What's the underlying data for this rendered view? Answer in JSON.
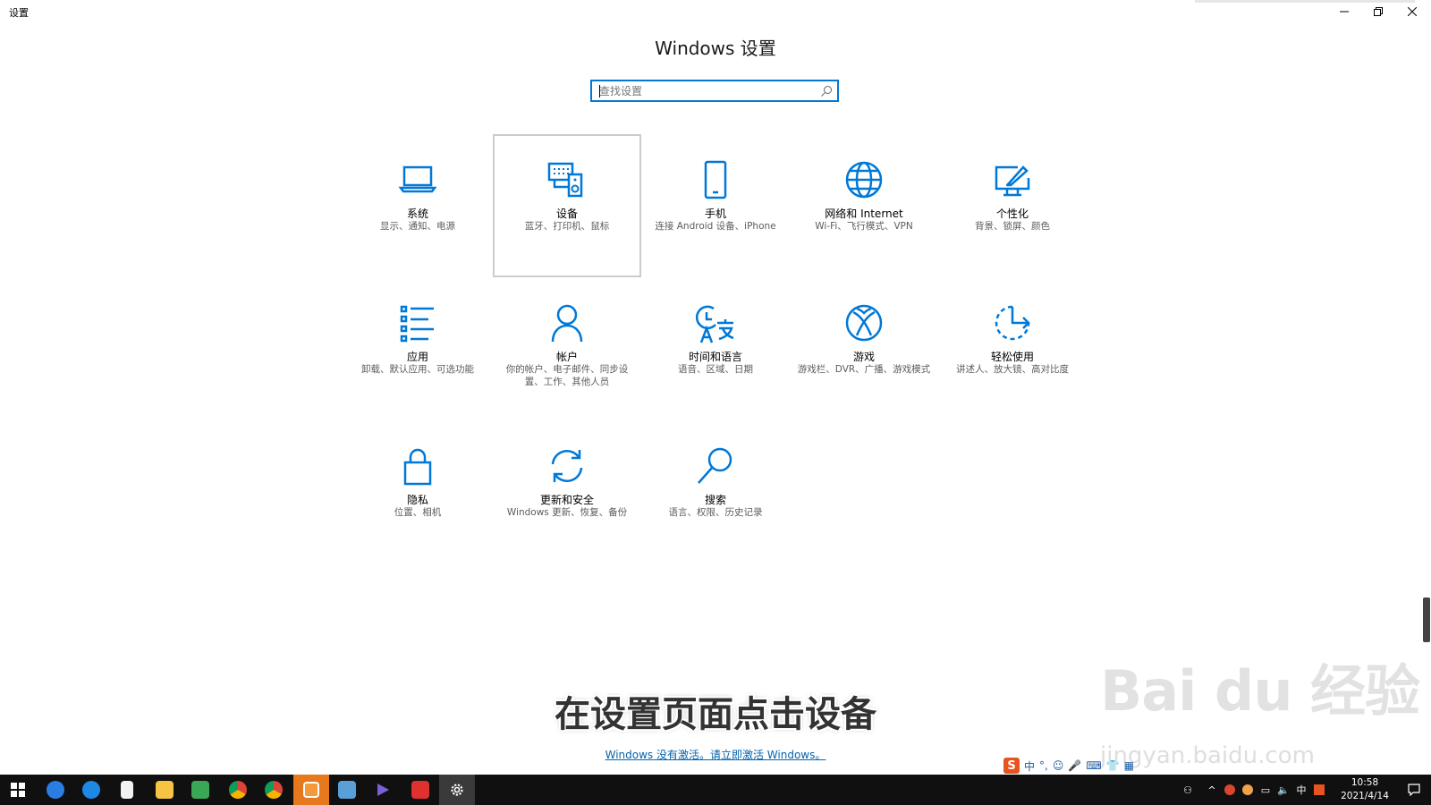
{
  "window": {
    "title": "设置"
  },
  "header": {
    "title": "Windows 设置"
  },
  "search": {
    "placeholder": "查找设置"
  },
  "tiles": [
    {
      "name": "系统",
      "desc": "显示、通知、电源"
    },
    {
      "name": "设备",
      "desc": "蓝牙、打印机、鼠标"
    },
    {
      "name": "手机",
      "desc": "连接 Android 设备、iPhone"
    },
    {
      "name": "网络和 Internet",
      "desc": "Wi-Fi、飞行模式、VPN"
    },
    {
      "name": "个性化",
      "desc": "背景、锁屏、颜色"
    },
    {
      "name": "应用",
      "desc": "卸载、默认应用、可选功能"
    },
    {
      "name": "帐户",
      "desc": "你的帐户、电子邮件、同步设置、工作、其他人员"
    },
    {
      "name": "时间和语言",
      "desc": "语音、区域、日期"
    },
    {
      "name": "游戏",
      "desc": "游戏栏、DVR、广播、游戏模式"
    },
    {
      "name": "轻松使用",
      "desc": "讲述人、放大镜、高对比度"
    },
    {
      "name": "隐私",
      "desc": "位置、相机"
    },
    {
      "name": "更新和安全",
      "desc": "Windows 更新、恢复、备份"
    },
    {
      "name": "搜索",
      "desc": "语言、权限、历史记录"
    }
  ],
  "caption": "在设置页面点击设备",
  "activation": "Windows 没有激活。请立即激活 Windows。",
  "watermark": {
    "main": "Bai du 经验",
    "sub": "jingyan.baidu.com"
  },
  "ime": {
    "lang": "中"
  },
  "taskbar": {
    "tray_lang": "中",
    "time": "10:58",
    "date": "2021/4/14"
  },
  "colors": {
    "accent": "#0078d7",
    "taskbar": "#101010"
  }
}
